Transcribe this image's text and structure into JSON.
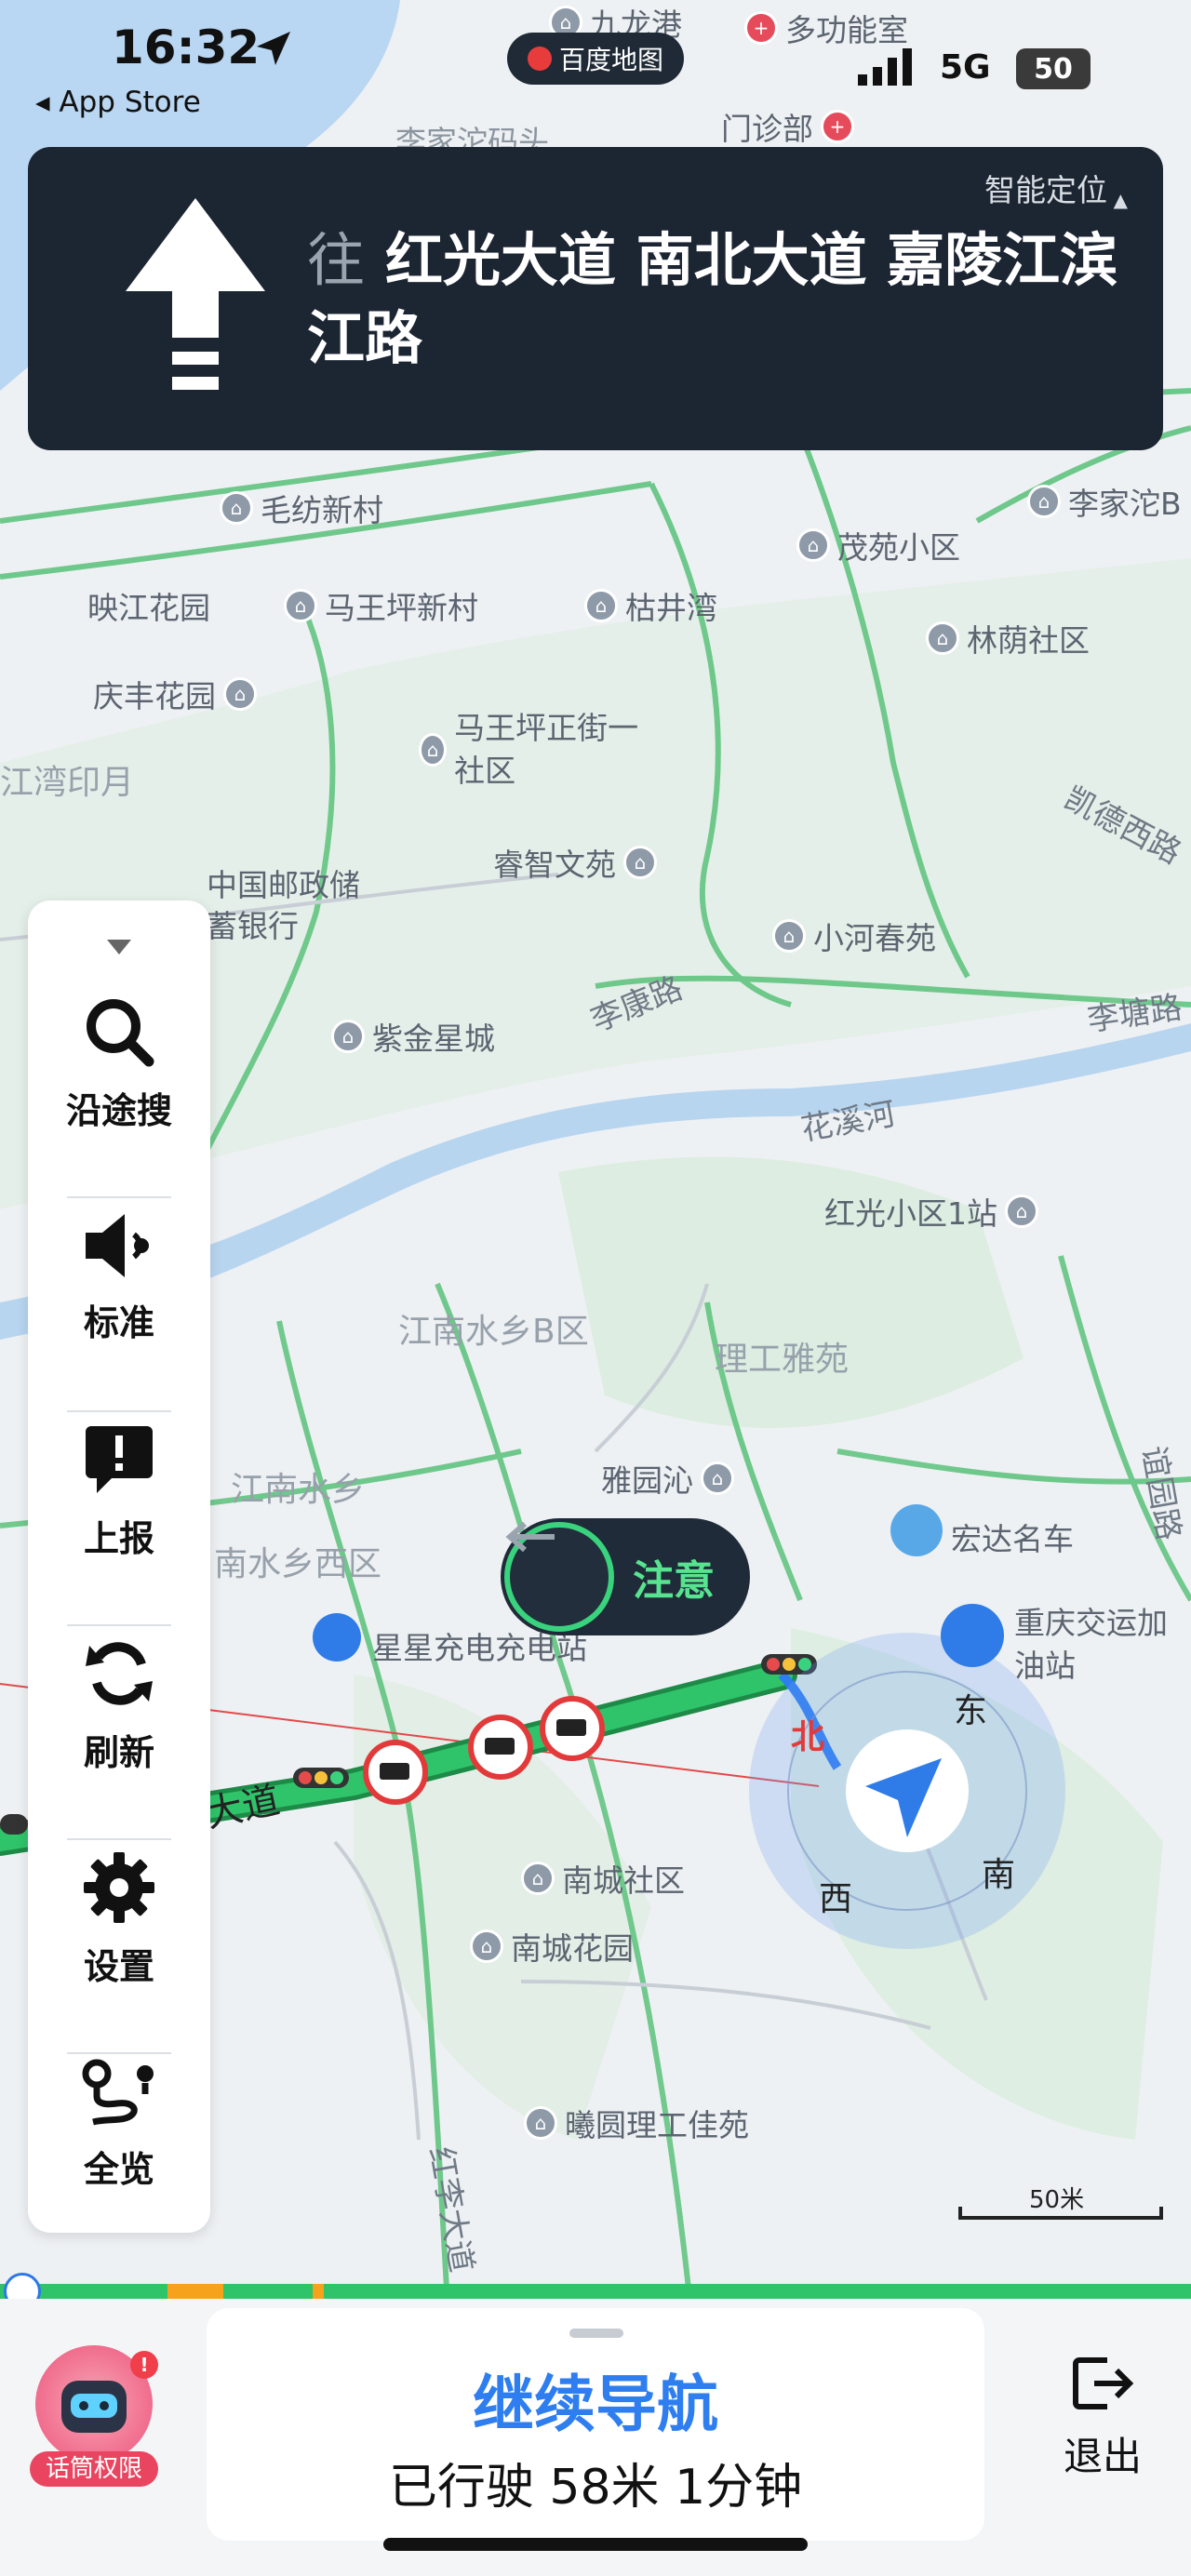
{
  "status_bar": {
    "time": "16:32",
    "back_app": "App Store",
    "app_badge": "百度地图",
    "network": "5G",
    "battery": "50"
  },
  "guidance": {
    "mode": "智能定位",
    "prefix": "往",
    "destination_roads": "红光大道 南北大道 嘉陵江滨江路",
    "direction_icon": "straight-arrow-icon"
  },
  "map": {
    "pois": [
      "九龙港",
      "多功能室",
      "李家沱码头",
      "门诊部",
      "毛纺新村",
      "茂苑小区",
      "李家沱B",
      "映江花园",
      "马王坪新村",
      "枯井湾",
      "林荫社区",
      "庆丰花园",
      "马王坪正街一社区",
      "睿智文苑",
      "中国邮政储蓄银行",
      "小河春苑",
      "紫金星城",
      "红光小区1站",
      "雅园沁",
      "宏达名车",
      "重庆交运加油站",
      "星星充电充电站",
      "南城社区",
      "南城花园",
      "曦圆理工佳苑"
    ],
    "area_labels": [
      "江湾印月",
      "江南水乡B区",
      "理工雅苑",
      "江南水乡",
      "南水乡西区"
    ],
    "road_labels": [
      "李康路",
      "李塘路",
      "花溪河",
      "凯德西路",
      "谊园路",
      "红李大道",
      "大道"
    ],
    "alert": "注意",
    "compass": {
      "north": "北",
      "east": "东",
      "south": "南",
      "west": "西"
    },
    "scale": "50米"
  },
  "side_panel": {
    "items": [
      {
        "label": "沿途搜",
        "icon": "search-icon"
      },
      {
        "label": "标准",
        "icon": "speaker-icon"
      },
      {
        "label": "上报",
        "icon": "report-icon"
      },
      {
        "label": "刷新",
        "icon": "refresh-icon"
      },
      {
        "label": "设置",
        "icon": "gear-icon"
      },
      {
        "label": "全览",
        "icon": "route-overview-icon"
      }
    ]
  },
  "bottom": {
    "continue_label": "继续导航",
    "trip_info": "已行驶 58米 1分钟",
    "exit_label": "退出",
    "assistant_tag": "话筒权限",
    "assistant_badge": "!"
  },
  "colors": {
    "route_green": "#2fc46a",
    "route_border": "#1e8a48",
    "accent_blue": "#2e7ef0",
    "card_dark": "#1c2532",
    "congestion_orange": "#f7a21b"
  }
}
